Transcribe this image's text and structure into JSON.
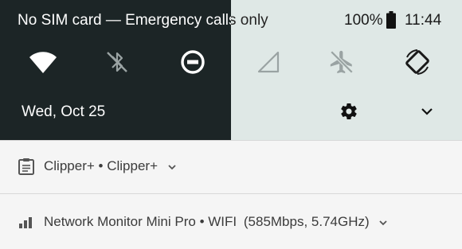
{
  "statusbar": {
    "sim_text": "No SIM card — Emergency calls only",
    "battery_pct": "100%",
    "time": "11:44"
  },
  "quick_settings": {
    "tiles": [
      {
        "name": "wifi",
        "icon": "wifi-icon"
      },
      {
        "name": "bluetooth",
        "icon": "bluetooth-off-icon"
      },
      {
        "name": "do-not-disturb",
        "icon": "do-not-disturb-icon"
      },
      {
        "name": "cellular",
        "icon": "cellular-signal-icon"
      },
      {
        "name": "airplane-mode",
        "icon": "airplane-mode-off-icon"
      },
      {
        "name": "auto-rotate",
        "icon": "screen-rotation-icon"
      }
    ],
    "date": "Wed, Oct 25"
  },
  "notifications": [
    {
      "app": "Clipper+",
      "title": "Clipper+",
      "icon": "clipboard-icon"
    },
    {
      "app": "Network Monitor Mini Pro",
      "title": "WIFI",
      "detail": "(585Mbps, 5.74GHz)",
      "icon": "signal-bars-icon"
    }
  ],
  "colors": {
    "shade_dark": "#1c2526",
    "shade_light": "#dfe8e6",
    "notification_bg": "#f5f5f5"
  }
}
